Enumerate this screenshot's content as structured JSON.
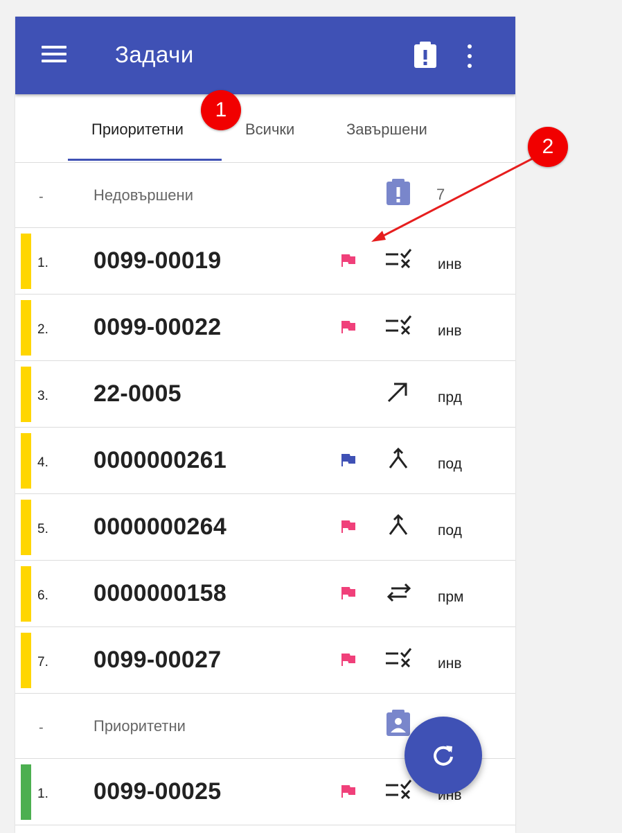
{
  "appbar": {
    "title": "Задачи",
    "color": "#3f51b5"
  },
  "tabs": [
    {
      "label": "Приоритетни",
      "active": true
    },
    {
      "label": "Всички",
      "active": false
    },
    {
      "label": "Завършени",
      "active": false
    }
  ],
  "sections": [
    {
      "dash": "-",
      "label": "Недовършени",
      "count": "7",
      "icon": "clipboard-alert-icon"
    },
    {
      "dash": "-",
      "label": "Приоритетни",
      "count": "",
      "icon": "clipboard-account-icon"
    }
  ],
  "tasks": [
    {
      "num": "1.",
      "code": "0099-00019",
      "flag": "pink",
      "type_icon": "checklist-x-icon",
      "abbr": "инв",
      "bar": "yellow"
    },
    {
      "num": "2.",
      "code": "0099-00022",
      "flag": "pink",
      "type_icon": "checklist-x-icon",
      "abbr": "инв",
      "bar": "yellow"
    },
    {
      "num": "3.",
      "code": "22-0005",
      "flag": "none",
      "type_icon": "arrow-up-right-icon",
      "abbr": "прд",
      "bar": "yellow"
    },
    {
      "num": "4.",
      "code": "0000000261",
      "flag": "blue",
      "type_icon": "merge-icon",
      "abbr": "под",
      "bar": "yellow"
    },
    {
      "num": "5.",
      "code": "0000000264",
      "flag": "pink",
      "type_icon": "merge-icon",
      "abbr": "под",
      "bar": "yellow"
    },
    {
      "num": "6.",
      "code": "0000000158",
      "flag": "pink",
      "type_icon": "swap-arrows-icon",
      "abbr": "прм",
      "bar": "yellow"
    },
    {
      "num": "7.",
      "code": "0099-00027",
      "flag": "pink",
      "type_icon": "checklist-x-icon",
      "abbr": "инв",
      "bar": "yellow"
    },
    {
      "num": "1.",
      "code": "0099-00025",
      "flag": "pink",
      "type_icon": "checklist-x-icon",
      "abbr": "инв",
      "bar": "green"
    }
  ],
  "annotations": [
    {
      "label": "1"
    },
    {
      "label": "2"
    }
  ],
  "colors": {
    "primary": "#3f51b5",
    "flag_pink": "#f0407a",
    "flag_blue": "#3f51b5",
    "bar_yellow": "#ffd600",
    "bar_green": "#4caf50",
    "section_icon": "#7986cb",
    "annotation_red": "#f10000"
  }
}
